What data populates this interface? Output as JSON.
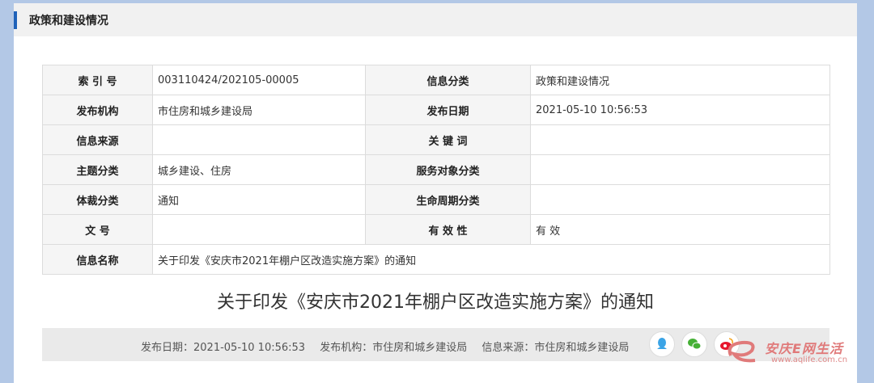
{
  "panel": {
    "title": "政策和建设情况"
  },
  "meta": {
    "rows": [
      [
        {
          "label": "索 引 号",
          "value": "003110424/202105-00005"
        },
        {
          "label": "信息分类",
          "value": "政策和建设情况"
        }
      ],
      [
        {
          "label": "发布机构",
          "value": "市住房和城乡建设局"
        },
        {
          "label": "发布日期",
          "value": "2021-05-10 10:56:53"
        }
      ],
      [
        {
          "label": "信息来源",
          "value": ""
        },
        {
          "label": "关 键 词",
          "value": ""
        }
      ],
      [
        {
          "label": "主题分类",
          "value": "城乡建设、住房"
        },
        {
          "label": "服务对象分类",
          "value": ""
        }
      ],
      [
        {
          "label": "体裁分类",
          "value": "通知"
        },
        {
          "label": "生命周期分类",
          "value": ""
        }
      ],
      [
        {
          "label": "文 号",
          "value": ""
        },
        {
          "label": "有 效 性",
          "value": "有 效"
        }
      ]
    ],
    "name_label": "信息名称",
    "name_value": "关于印发《安庆市2021年棚户区改造实施方案》的通知"
  },
  "doc_title": "关于印发《安庆市2021年棚户区改造实施方案》的通知",
  "footer": {
    "publish_date": "发布日期：2021-05-10 10:56:53",
    "publisher": "发布机构：市住房和城乡建设局",
    "source": "信息来源：市住房和城乡建设局"
  },
  "share_icons": [
    "qq-icon",
    "wechat-icon",
    "weibo-icon"
  ],
  "watermark": {
    "text": "安庆E网生活",
    "url": "www.aqlife.com.cn"
  },
  "colors": {
    "accent": "#1f62b9",
    "page_bg": "#b3c8e6",
    "label_bg": "#f5f5f5"
  }
}
